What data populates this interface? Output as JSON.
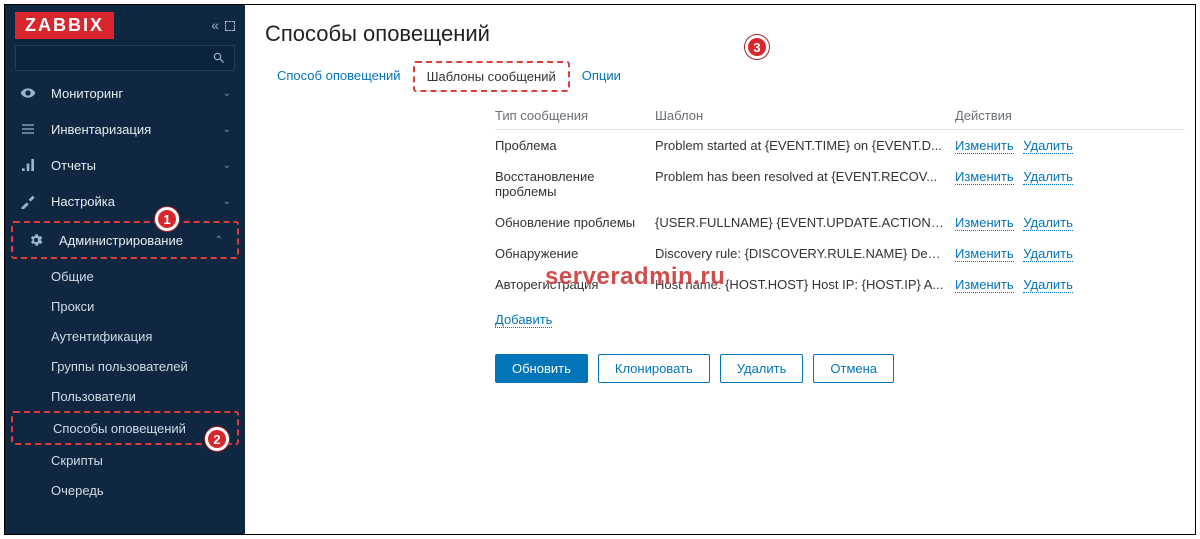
{
  "logo_text": "ZABBIX",
  "sidebar": {
    "monitoring": "Мониторинг",
    "inventory": "Инвентаризация",
    "reports": "Отчеты",
    "configuration": "Настройка",
    "administration": "Администрирование",
    "sub": {
      "general": "Общие",
      "proxies": "Прокси",
      "authentication": "Аутентификация",
      "user_groups": "Группы пользователей",
      "users": "Пользователи",
      "media_types": "Способы оповещений",
      "scripts": "Скрипты",
      "queue": "Очередь"
    }
  },
  "page_title": "Способы оповещений",
  "tabs": {
    "media_type": "Способ оповещений",
    "message_templates": "Шаблоны сообщений",
    "options": "Опции"
  },
  "table": {
    "headers": {
      "type": "Тип сообщения",
      "template": "Шаблон",
      "actions": "Действия"
    },
    "rows": [
      {
        "type": "Проблема",
        "template": "Problem started at {EVENT.TIME} on {EVENT.D..."
      },
      {
        "type": "Восстановление проблемы",
        "template": "Problem has been resolved at {EVENT.RECOV..."
      },
      {
        "type": "Обновление проблемы",
        "template": "{USER.FULLNAME} {EVENT.UPDATE.ACTION} ..."
      },
      {
        "type": "Обнаружение",
        "template": "Discovery rule: {DISCOVERY.RULE.NAME} Devi..."
      },
      {
        "type": "Авторегистрация",
        "template": "Host name: {HOST.HOST} Host IP: {HOST.IP} A..."
      }
    ],
    "action_edit": "Изменить",
    "action_delete": "Удалить",
    "add_link": "Добавить"
  },
  "buttons": {
    "update": "Обновить",
    "clone": "Клонировать",
    "delete": "Удалить",
    "cancel": "Отмена"
  },
  "watermark": "serveradmin.ru"
}
